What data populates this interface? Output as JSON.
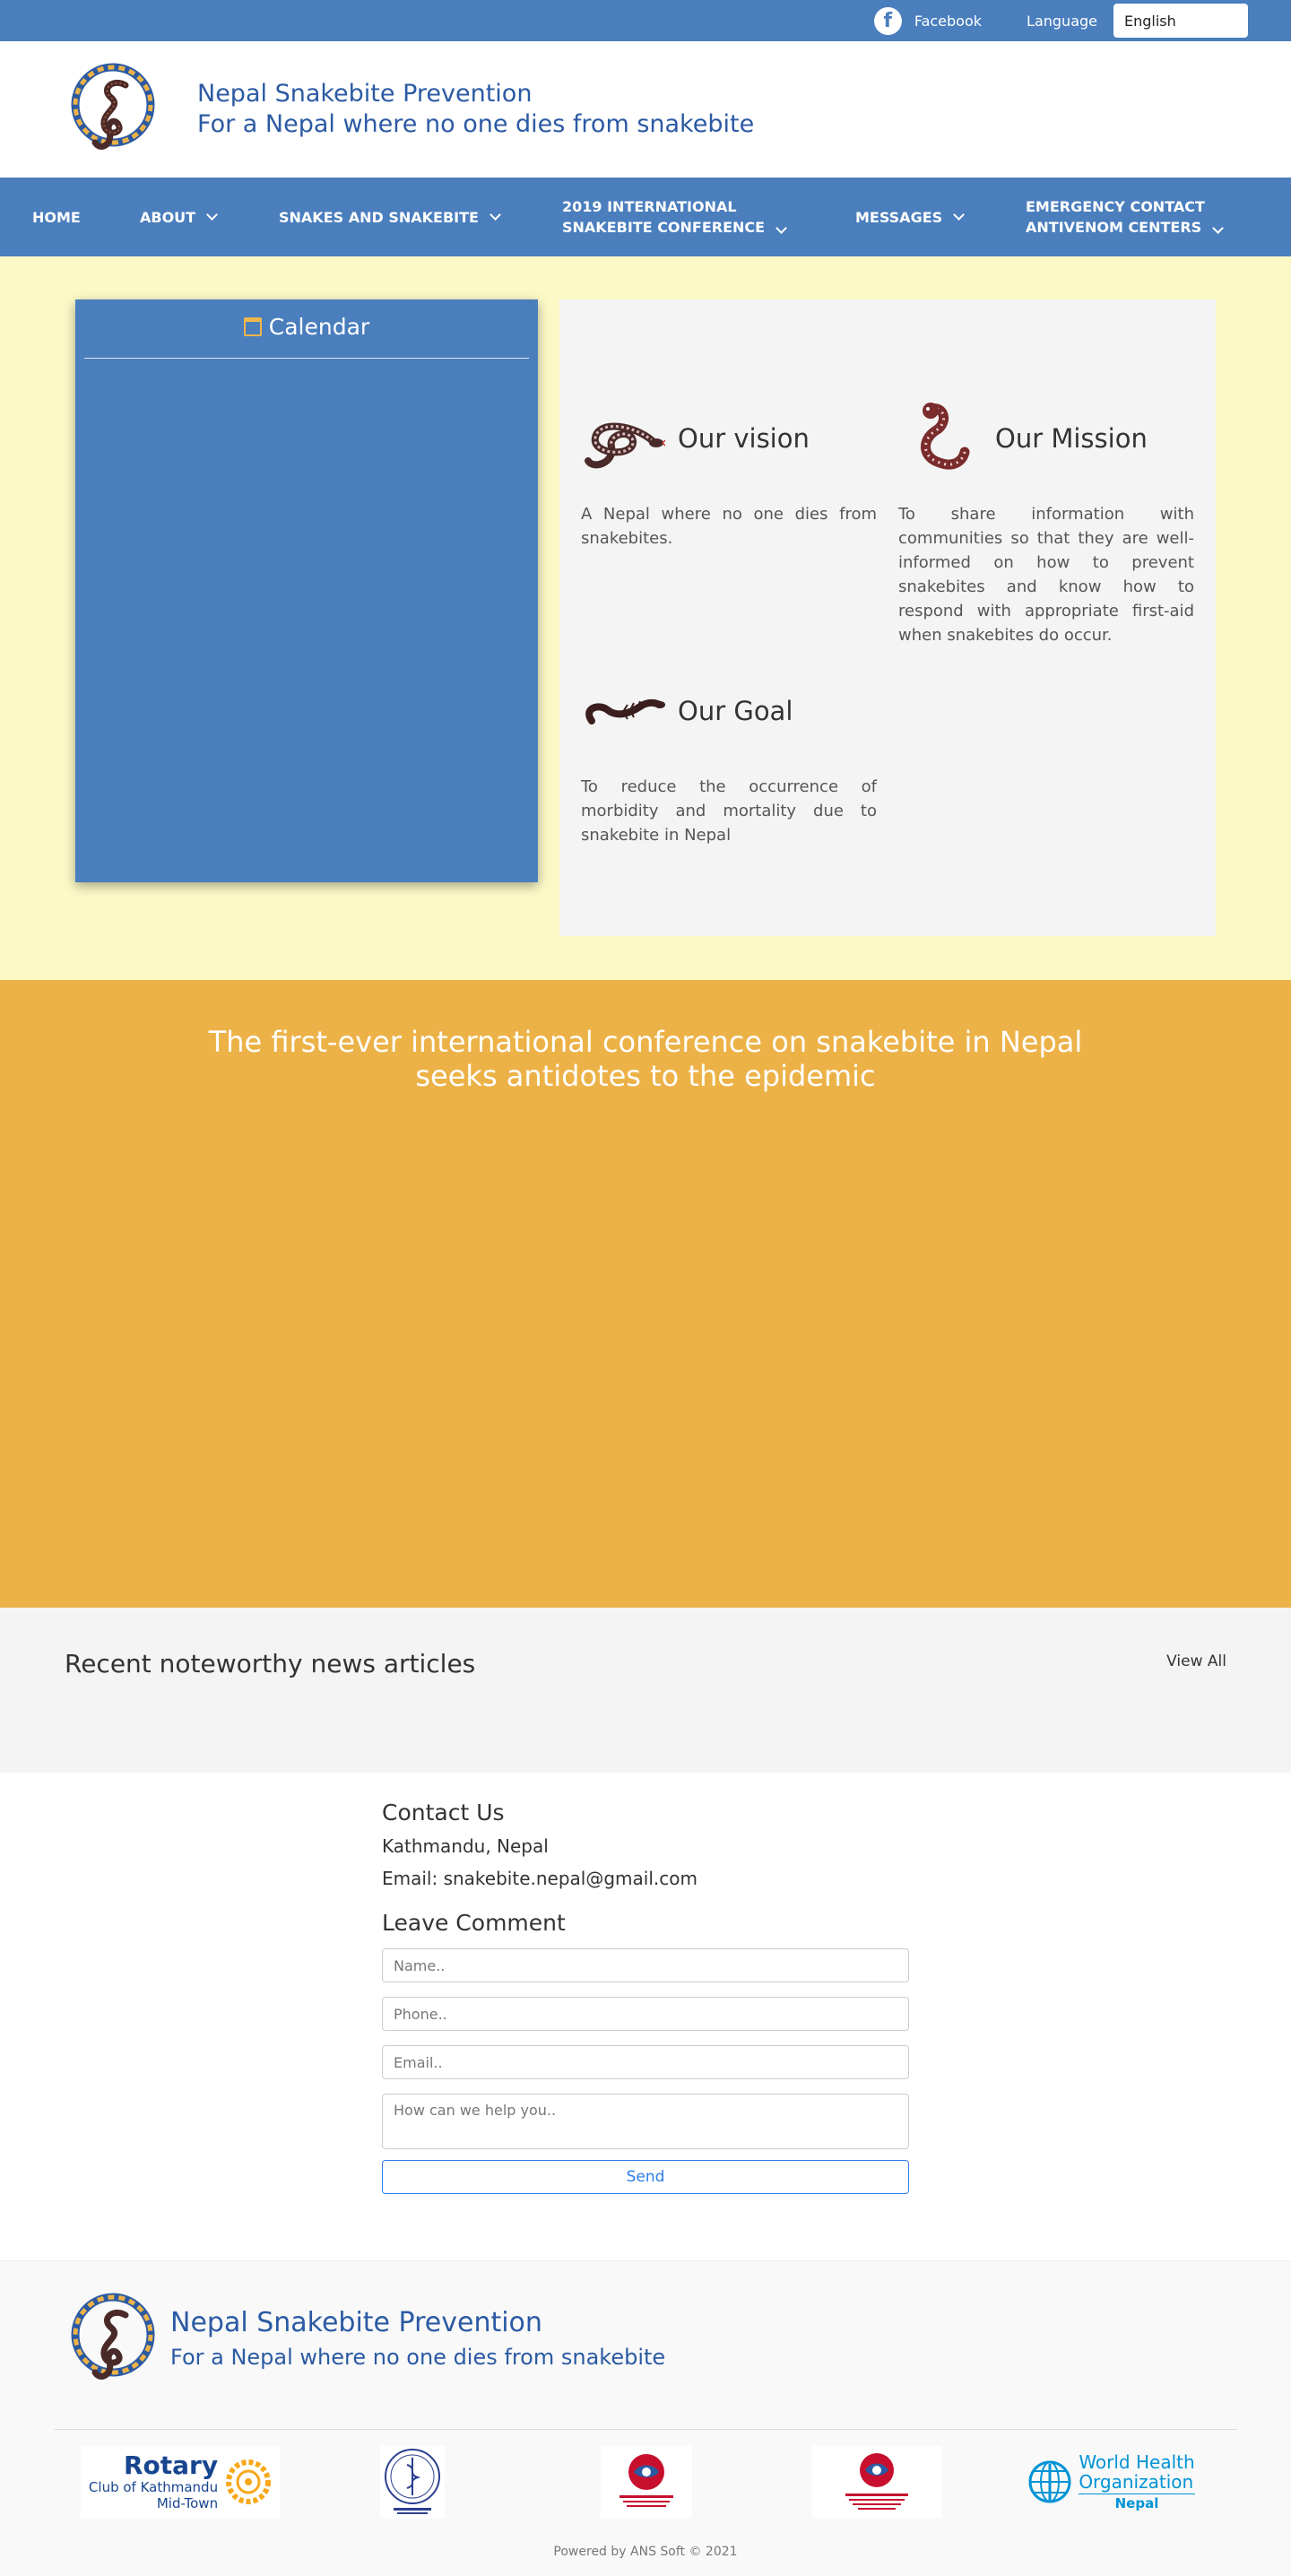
{
  "topbar": {
    "facebook_label": "Facebook",
    "language_label": "Language",
    "language_value": "English"
  },
  "header": {
    "title": "Nepal Snakebite Prevention",
    "tagline": "For a Nepal where no one dies from snakebite"
  },
  "nav": {
    "items": [
      {
        "line1": "HOME",
        "line2": ""
      },
      {
        "line1": "ABOUT",
        "line2": ""
      },
      {
        "line1": "SNAKES AND SNAKEBITE",
        "line2": ""
      },
      {
        "line1": "2019 INTERNATIONAL",
        "line2": "SNAKEBITE CONFERENCE"
      },
      {
        "line1": "MESSAGES",
        "line2": ""
      },
      {
        "line1": "EMERGENCY CONTACT",
        "line2": "ANTIVENOM CENTERS"
      }
    ]
  },
  "calendar": {
    "title": "Calendar"
  },
  "vision": {
    "title": "Our vision",
    "text": "A Nepal where no one dies from snakebites."
  },
  "mission": {
    "title": "Our Mission",
    "text": "To share information with communities so that they are well-informed on how to prevent snakebites and know how to respond with appropriate first-aid when snakebites do occur."
  },
  "goal": {
    "title": "Our Goal",
    "text": "To reduce the occurrence of morbidity and mortality due to snakebite in Nepal"
  },
  "feature": {
    "headline": "The first-ever international conference on snakebite in Nepal seeks antidotes to the epidemic"
  },
  "news": {
    "title": "Recent noteworthy news articles",
    "view_all": "View All"
  },
  "contact": {
    "title": "Contact Us",
    "address": "Kathmandu, Nepal",
    "email": "Email: snakebite.nepal@gmail.com",
    "comment_title": "Leave Comment",
    "name_placeholder": "Name..",
    "phone_placeholder": "Phone..",
    "email_placeholder": "Email..",
    "message_placeholder": "How can we help you..",
    "send_label": "Send"
  },
  "footer": {
    "title": "Nepal Snakebite Prevention",
    "tagline": "For a Nepal where no one dies from snakebite",
    "powered_by": "Powered by ANS Soft © 2021",
    "partners": {
      "rotary_name": "Rotary",
      "rotary_line2": "Club of Kathmandu",
      "rotary_line3": "Mid-Town",
      "who_line1": "World Health",
      "who_line2": "Organization",
      "who_line3": "Nepal"
    }
  },
  "colors": {
    "primary_blue": "#4a7ebd",
    "title_blue": "#2b5aa3",
    "cream": "#fcf9c7",
    "orange": "#ecb247"
  }
}
